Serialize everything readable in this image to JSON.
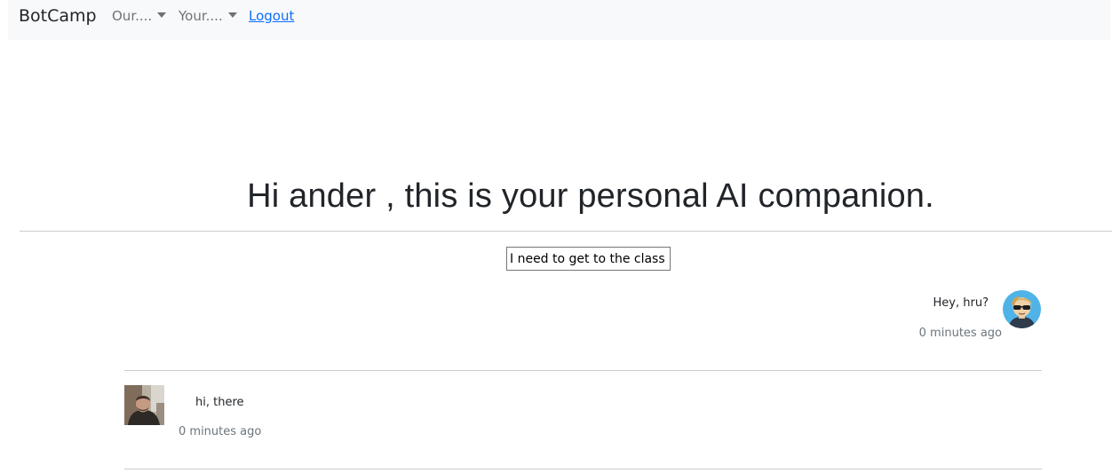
{
  "navbar": {
    "brand": "BotCamp",
    "dropdown_1": "Our....",
    "dropdown_2": "Your....",
    "logout": "Logout"
  },
  "main": {
    "headline": "Hi ander , this is your personal AI companion.",
    "input_value": "I need to get to the class"
  },
  "chat": {
    "messages": [
      {
        "sender": "bot",
        "text": "Hey, hru?",
        "time": "0 minutes ago",
        "avatar": "sunglasses-avatar-icon"
      },
      {
        "sender": "user",
        "text": "hi, there",
        "time": "0 minutes ago",
        "avatar": "user-photo"
      }
    ]
  },
  "colors": {
    "navbar_bg": "#f8f9fa",
    "link": "#0d6efd",
    "muted": "#6c757d",
    "divider": "#c9ccd0",
    "avatar_bg": "#4fb3e8"
  }
}
